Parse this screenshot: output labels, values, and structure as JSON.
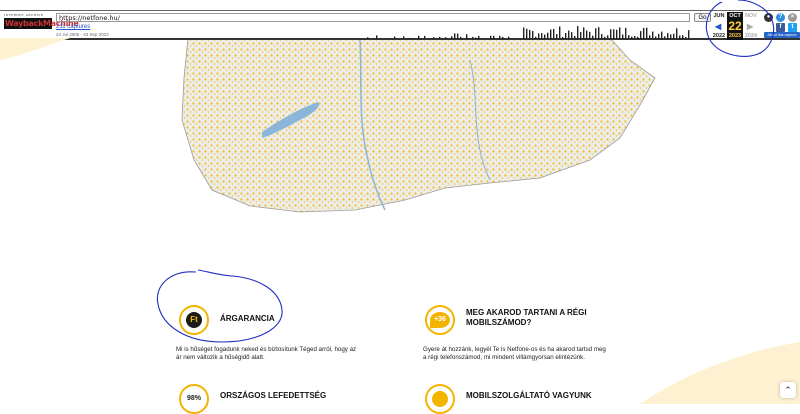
{
  "wayback": {
    "logo_line1": "INTERNET ARCHIVE",
    "logo_line2": "WaybackMachine",
    "url": "https://netfone.hu/",
    "go_label": "Go",
    "captures_label": "211 captures",
    "range_label": "24 Jul 2005 - 23 Sep 2022",
    "calendar": {
      "prev_month": "JUN",
      "cur_month": "OCT",
      "next_month": "NOV",
      "day": "22",
      "prev_year": "2022",
      "cur_year": "2023",
      "next_year": "2024"
    },
    "about_label": "About this capture",
    "icon_names": [
      "user-icon",
      "help-icon",
      "close-icon",
      "facebook-icon",
      "twitter-icon"
    ]
  },
  "features": [
    {
      "title": "ÁRGARANCIA",
      "icon_text": "Ft",
      "text_line1": "Mi is hűséget fogadunk neked és biztosítunk Téged arról, hogy az",
      "text_line2": "ár nem változik a hűségidő alatt."
    },
    {
      "title_line1": "MEG AKAROD TARTANI A RÉGI",
      "title_line2": "MOBILSZÁMOD?",
      "icon_text": "+36",
      "text_line1": "Gyere át hozzánk, legyél Te is Netfone-os és ha akarod tartsd meg",
      "text_line2": "a régi telefonszámod, mi mindent villámgyorsan elintézünk."
    },
    {
      "title": "ORSZÁGOS LEFEDETTSÉG",
      "icon_text": "98%"
    },
    {
      "title": "MOBILSZOLGÁLTATÓ VAGYUNK",
      "icon_text": ""
    }
  ],
  "colors": {
    "accent": "#f3b400",
    "annotation": "#1f2fbf"
  }
}
